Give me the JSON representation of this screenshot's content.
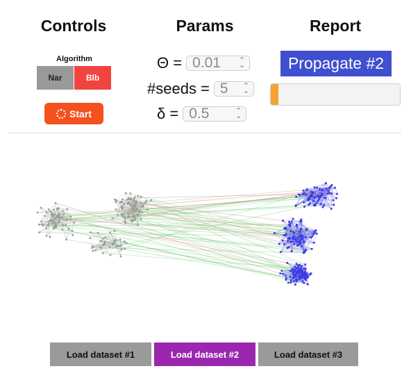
{
  "headers": {
    "controls": "Controls",
    "params": "Params",
    "report": "Report"
  },
  "controls": {
    "algorithm_label": "Algorithm",
    "algorithms": [
      "Nar",
      "Blb"
    ],
    "selected_algorithm": "Blb",
    "start_label": "Start"
  },
  "params": {
    "theta": {
      "label": "Θ =",
      "value": "0.01"
    },
    "seeds": {
      "label": "#seeds =",
      "value": "5"
    },
    "delta": {
      "label": "δ =",
      "value": "0.5"
    }
  },
  "report": {
    "propagate_label": "Propagate #2",
    "progress_fraction": 0.06
  },
  "datasets": [
    "Load dataset #1",
    "Load dataset #2",
    "Load dataset #3"
  ],
  "selected_dataset": "Load dataset #2",
  "colors": {
    "gray_nodes": "#9a9a9a",
    "blue_nodes": "#3b3be6",
    "green_edges": "#7fcf7f",
    "red_edges": "#e36d7b",
    "start_button": "#f4511e",
    "propagate_button": "#3f4fd0",
    "progress": "#f4a331",
    "selected_dataset": "#9b27b0",
    "selected_algorithm": "#f2443f"
  }
}
